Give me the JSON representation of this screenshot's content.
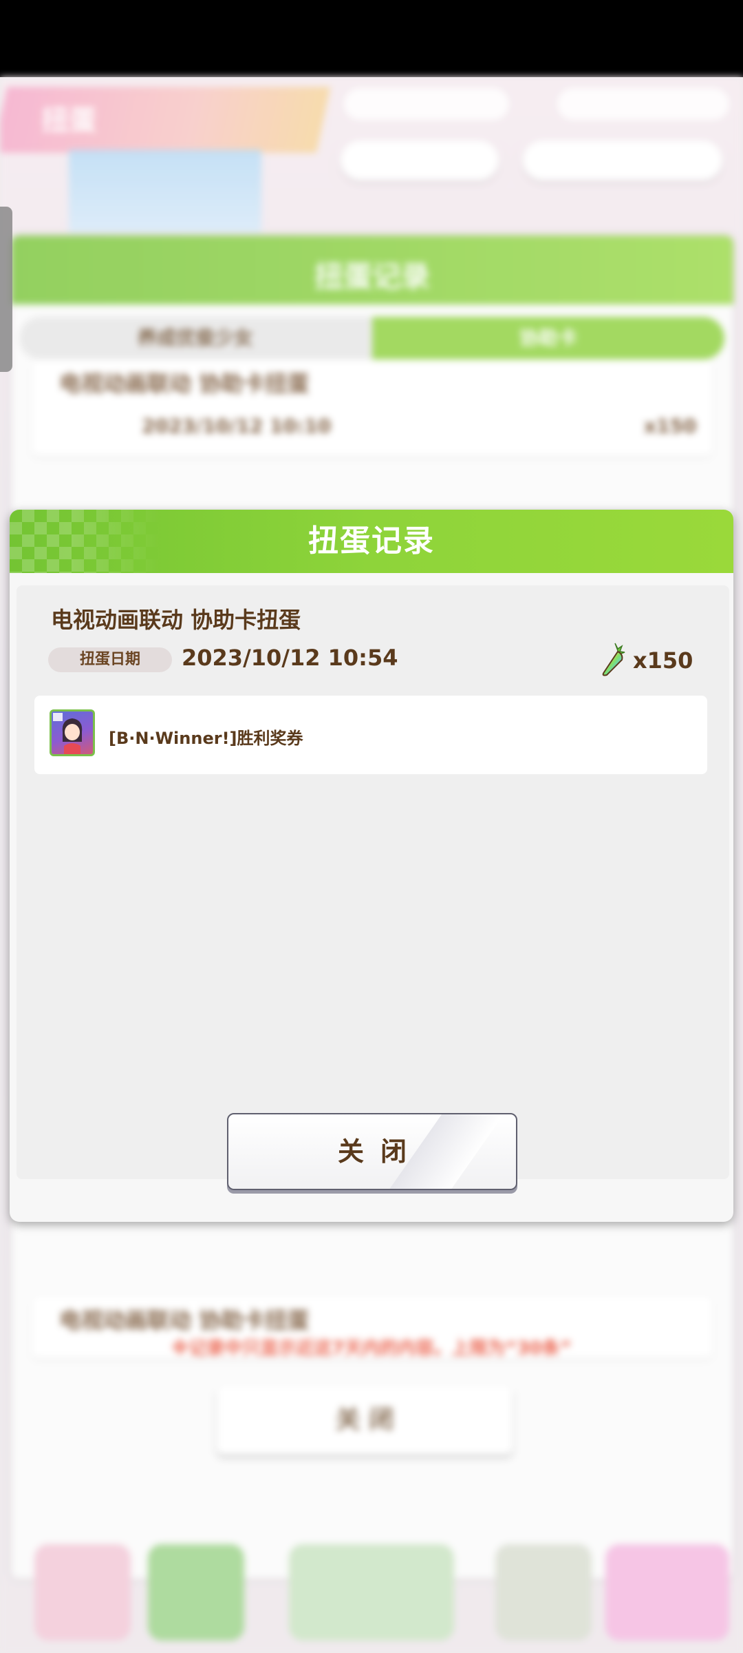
{
  "background": {
    "header_title": "扭蛋",
    "panel_title": "扭蛋记录",
    "tabs": [
      "养成优俊少女",
      "协助卡"
    ],
    "card_titles": [
      "电视动画联动  协助卡扭蛋",
      "电视动画联动  协助卡扭蛋"
    ],
    "card_date": "2023/10/12  10:10",
    "card_cost": "x150",
    "note": "※记录中只显示近这7天内的内容。上限为“30条”",
    "close_label": "关 闭"
  },
  "modal": {
    "title": "扭蛋记录",
    "gacha_name": "电视动画联动  协助卡扭蛋",
    "date_label": "扭蛋日期",
    "date_value": "2023/10/12  10:54",
    "cost_icon": "rainbow-carrot-icon",
    "cost_value": "x150",
    "results": [
      {
        "name": "[B·N·Winner!]胜利奖券"
      }
    ],
    "close_label": "关闭"
  },
  "colors": {
    "header_green": "#8ed43a",
    "text_brown": "#5a3a1c",
    "note_red": "#e8472e"
  }
}
